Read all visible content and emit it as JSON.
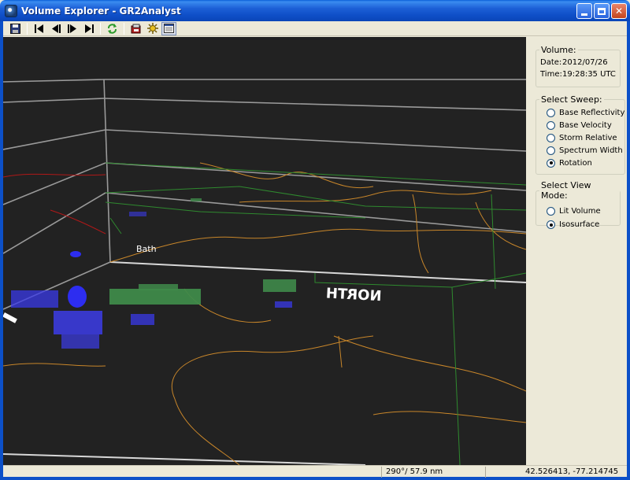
{
  "window": {
    "title": "Volume Explorer - GR2Analyst"
  },
  "toolbar": {
    "buttons": [
      "save-icon",
      "first-frame-icon",
      "previous-frame-icon",
      "next-frame-icon",
      "last-frame-icon",
      "refresh-icon",
      "export-icon",
      "settings-icon",
      "panel-toggle-icon"
    ]
  },
  "view": {
    "town_label": "Bath",
    "direction_label": "NORTH"
  },
  "volume": {
    "legend": "Volume:",
    "date_key": "Date:",
    "date_value": "2012/07/26",
    "time_key": "Time:",
    "time_value": "19:28:35 UTC"
  },
  "sweep": {
    "legend": "Select Sweep:",
    "options": [
      {
        "label": "Base Reflectivity",
        "checked": false
      },
      {
        "label": "Base Velocity",
        "checked": false
      },
      {
        "label": "Storm Relative",
        "checked": false
      },
      {
        "label": "Spectrum Width",
        "checked": false
      },
      {
        "label": "Rotation",
        "checked": true
      }
    ]
  },
  "view_mode": {
    "legend": "Select View Mode:",
    "options": [
      {
        "label": "Lit Volume",
        "checked": false
      },
      {
        "label": "Isosurface",
        "checked": true
      }
    ]
  },
  "status": {
    "bearing_range": "290°/ 57.9 nm",
    "coordinates": "42.526413, -77.214745"
  },
  "colors": {
    "titlebar": "#0f4fc8",
    "view_background": "#222222",
    "grid": "#d0d0d0",
    "county_lines": "#c8862a",
    "state_lines": "#2f8a2f",
    "road_lines": "#b01818",
    "echo_blue": "#3a3ae8",
    "echo_green": "#3f8a4a"
  }
}
